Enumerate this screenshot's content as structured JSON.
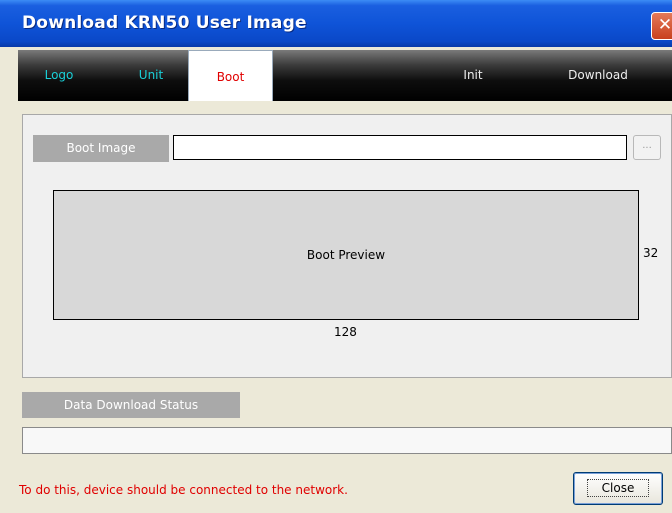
{
  "window": {
    "title": "Download KRN50 User Image",
    "close_glyph": "✕"
  },
  "tabs": [
    {
      "label": "Logo",
      "active": false
    },
    {
      "label": "Unit",
      "active": false
    },
    {
      "label": "Boot",
      "active": true
    },
    {
      "label": "Init",
      "active": false
    },
    {
      "label": "Download",
      "active": false
    }
  ],
  "boot": {
    "image_label": "Boot Image",
    "image_path": "",
    "browse_label": "...",
    "preview_label": "Boot Preview",
    "height": "32",
    "width": "128"
  },
  "status": {
    "label": "Data Download Status",
    "progress": 0
  },
  "footer": {
    "note": "To do this, device should be connected to the network.",
    "close_label": "Close"
  },
  "colors": {
    "titlebar": "#0f54d8",
    "tab_inactive_left": "#1ad0d8",
    "tab_active_text": "#e00000",
    "note_text": "#e00000"
  }
}
